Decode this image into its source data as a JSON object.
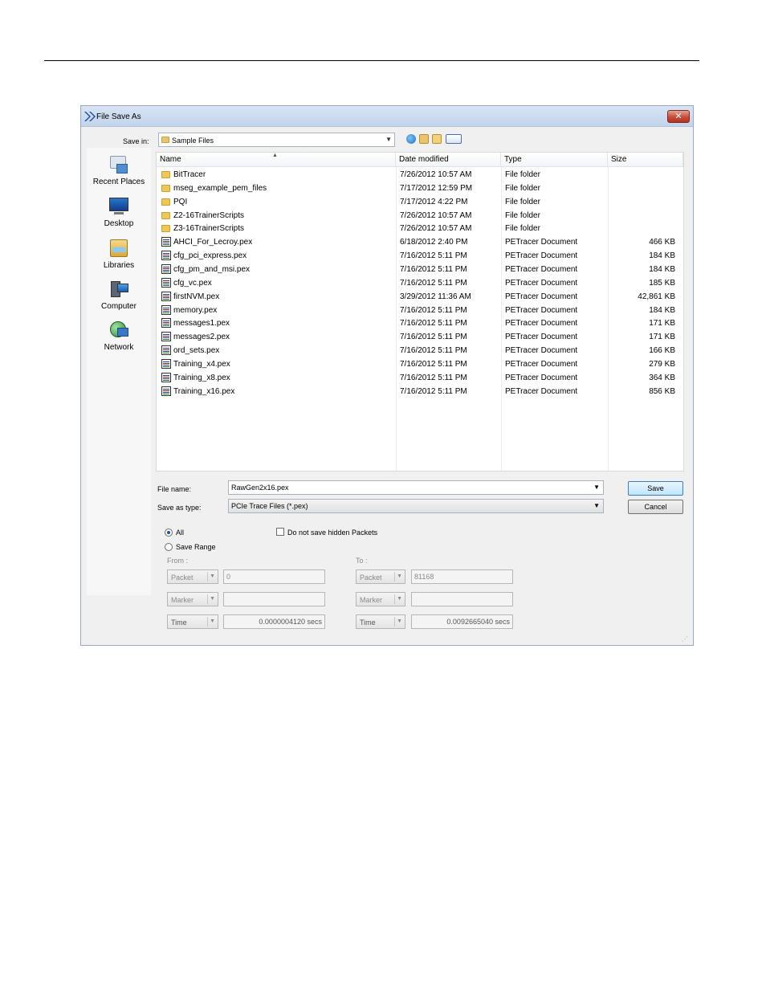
{
  "window": {
    "title": "File Save As",
    "close_label": "✕"
  },
  "toolbar": {
    "save_in_label": "Save in:",
    "save_in_value": "Sample Files"
  },
  "places": [
    {
      "label": "Recent Places",
      "icon": "recent-places-icon"
    },
    {
      "label": "Desktop",
      "icon": "desktop-icon"
    },
    {
      "label": "Libraries",
      "icon": "libraries-icon"
    },
    {
      "label": "Computer",
      "icon": "computer-icon"
    },
    {
      "label": "Network",
      "icon": "network-icon"
    }
  ],
  "columns": {
    "name": "Name",
    "date": "Date modified",
    "type": "Type",
    "size": "Size"
  },
  "files": [
    {
      "name": "BitTracer",
      "date": "7/26/2012 10:57 AM",
      "type": "File folder",
      "size": "",
      "kind": "folder"
    },
    {
      "name": "mseg_example_pem_files",
      "date": "7/17/2012 12:59 PM",
      "type": "File folder",
      "size": "",
      "kind": "folder"
    },
    {
      "name": "PQI",
      "date": "7/17/2012 4:22 PM",
      "type": "File folder",
      "size": "",
      "kind": "folder"
    },
    {
      "name": "Z2-16TrainerScripts",
      "date": "7/26/2012 10:57 AM",
      "type": "File folder",
      "size": "",
      "kind": "folder"
    },
    {
      "name": "Z3-16TrainerScripts",
      "date": "7/26/2012 10:57 AM",
      "type": "File folder",
      "size": "",
      "kind": "folder"
    },
    {
      "name": "AHCI_For_Lecroy.pex",
      "date": "6/18/2012 2:40 PM",
      "type": "PETracer Document",
      "size": "466 KB",
      "kind": "pex"
    },
    {
      "name": "cfg_pci_express.pex",
      "date": "7/16/2012 5:11 PM",
      "type": "PETracer Document",
      "size": "184 KB",
      "kind": "pex"
    },
    {
      "name": "cfg_pm_and_msi.pex",
      "date": "7/16/2012 5:11 PM",
      "type": "PETracer Document",
      "size": "184 KB",
      "kind": "pex"
    },
    {
      "name": "cfg_vc.pex",
      "date": "7/16/2012 5:11 PM",
      "type": "PETracer Document",
      "size": "185 KB",
      "kind": "pex"
    },
    {
      "name": "firstNVM.pex",
      "date": "3/29/2012 11:36 AM",
      "type": "PETracer Document",
      "size": "42,861 KB",
      "kind": "pex"
    },
    {
      "name": "memory.pex",
      "date": "7/16/2012 5:11 PM",
      "type": "PETracer Document",
      "size": "184 KB",
      "kind": "pex"
    },
    {
      "name": "messages1.pex",
      "date": "7/16/2012 5:11 PM",
      "type": "PETracer Document",
      "size": "171 KB",
      "kind": "pex"
    },
    {
      "name": "messages2.pex",
      "date": "7/16/2012 5:11 PM",
      "type": "PETracer Document",
      "size": "171 KB",
      "kind": "pex"
    },
    {
      "name": "ord_sets.pex",
      "date": "7/16/2012 5:11 PM",
      "type": "PETracer Document",
      "size": "166 KB",
      "kind": "pex"
    },
    {
      "name": "Training_x4.pex",
      "date": "7/16/2012 5:11 PM",
      "type": "PETracer Document",
      "size": "279 KB",
      "kind": "pex"
    },
    {
      "name": "Training_x8.pex",
      "date": "7/16/2012 5:11 PM",
      "type": "PETracer Document",
      "size": "364 KB",
      "kind": "pex"
    },
    {
      "name": "Training_x16.pex",
      "date": "7/16/2012 5:11 PM",
      "type": "PETracer Document",
      "size": "856 KB",
      "kind": "pex"
    }
  ],
  "filename": {
    "label": "File name:",
    "value": "RawGen2x16.pex"
  },
  "savetype": {
    "label": "Save as type:",
    "value": "PCIe Trace Files (*.pex)"
  },
  "buttons": {
    "save": "Save",
    "cancel": "Cancel"
  },
  "options": {
    "all_label": "All",
    "range_label": "Save Range",
    "hidden_label": "Do not save hidden Packets",
    "all_selected": true,
    "hidden_checked": false
  },
  "range": {
    "from_label": "From :",
    "to_label": "To :",
    "from_packet_unit": "Packet",
    "from_packet_value": "0",
    "from_marker_unit": "Marker",
    "from_time_unit": "Time",
    "from_time_value": "0.0000004120 secs",
    "to_packet_unit": "Packet",
    "to_packet_value": "81168",
    "to_marker_unit": "Marker",
    "to_time_unit": "Time",
    "to_time_value": "0.0092665040 secs"
  },
  "colors": {
    "title_gradient": "#c3d5ec",
    "close": "#c74d3a",
    "folder": "#f0c654",
    "accent": "#2f5d9b"
  }
}
